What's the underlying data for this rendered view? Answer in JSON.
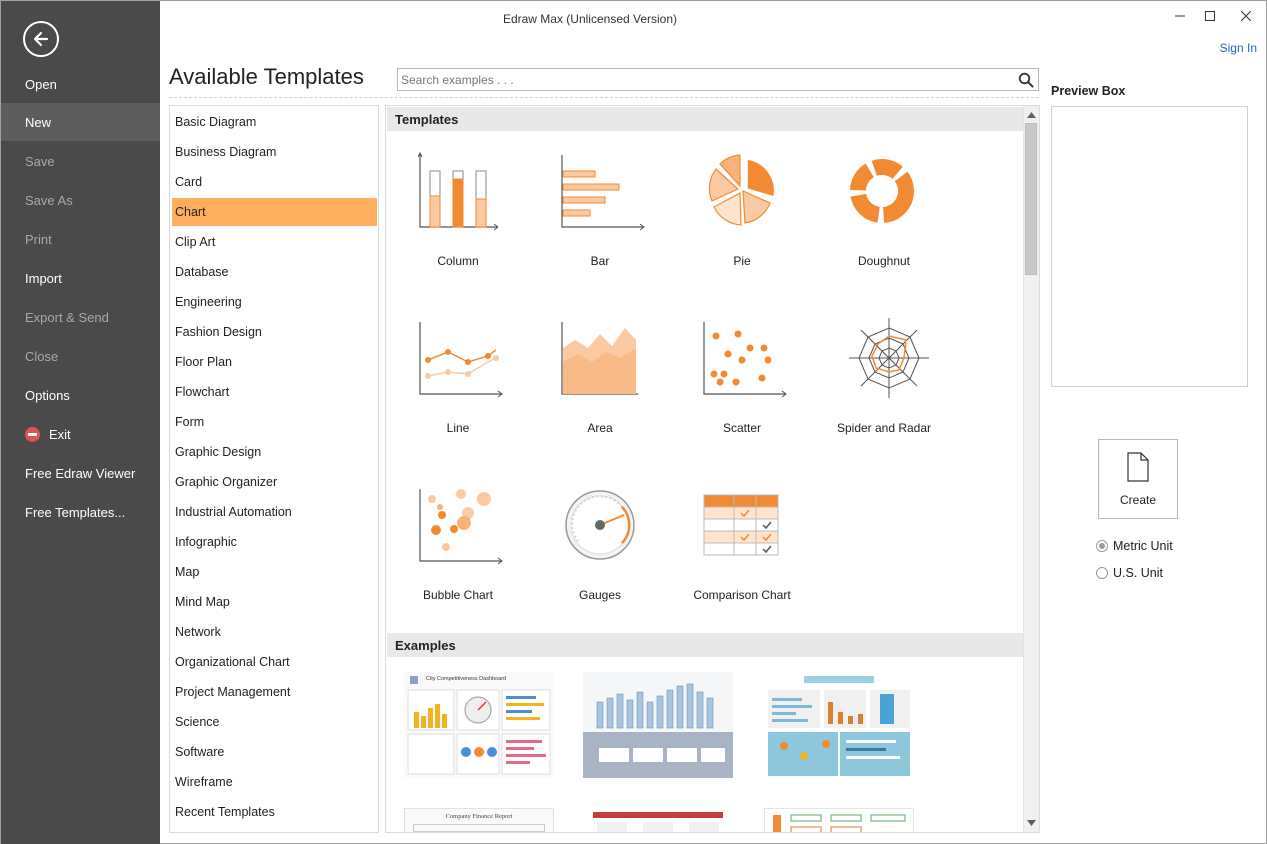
{
  "window": {
    "title": "Edraw Max (Unlicensed Version)",
    "sign_in": "Sign In"
  },
  "menu": {
    "items": [
      {
        "label": "Open"
      },
      {
        "label": "New"
      },
      {
        "label": "Save"
      },
      {
        "label": "Save As"
      },
      {
        "label": "Print"
      },
      {
        "label": "Import"
      },
      {
        "label": "Export & Send"
      },
      {
        "label": "Close"
      },
      {
        "label": "Options"
      },
      {
        "label": "Exit"
      },
      {
        "label": "Free Edraw Viewer"
      },
      {
        "label": "Free Templates..."
      }
    ],
    "active": "New",
    "disabled": [
      "Save",
      "Save As",
      "Print",
      "Export & Send",
      "Close"
    ]
  },
  "main": {
    "heading": "Available Templates",
    "search_placeholder": "Search examples . . ."
  },
  "categories": {
    "items": [
      "Basic Diagram",
      "Business Diagram",
      "Card",
      "Chart",
      "Clip Art",
      "Database",
      "Engineering",
      "Fashion Design",
      "Floor Plan",
      "Flowchart",
      "Form",
      "Graphic Design",
      "Graphic Organizer",
      "Industrial Automation",
      "Infographic",
      "Map",
      "Mind Map",
      "Network",
      "Organizational Chart",
      "Project Management",
      "Science",
      "Software",
      "Wireframe",
      "Recent Templates"
    ],
    "selected": "Chart"
  },
  "templates": {
    "header": "Templates",
    "items": [
      {
        "label": "Column",
        "icon": "column-chart-icon"
      },
      {
        "label": "Bar",
        "icon": "bar-chart-icon"
      },
      {
        "label": "Pie",
        "icon": "pie-chart-icon"
      },
      {
        "label": "Doughnut",
        "icon": "doughnut-chart-icon"
      },
      {
        "label": "Line",
        "icon": "line-chart-icon"
      },
      {
        "label": "Area",
        "icon": "area-chart-icon"
      },
      {
        "label": "Scatter",
        "icon": "scatter-chart-icon"
      },
      {
        "label": "Spider and Radar",
        "icon": "spider-radar-chart-icon"
      },
      {
        "label": "Bubble Chart",
        "icon": "bubble-chart-icon"
      },
      {
        "label": "Gauges",
        "icon": "gauge-icon"
      },
      {
        "label": "Comparison Chart",
        "icon": "comparison-chart-icon"
      }
    ]
  },
  "examples": {
    "header": "Examples",
    "items": [
      {
        "title": "City Competitiveness Dashboard"
      },
      {
        "title": ""
      },
      {
        "title": ""
      },
      {
        "title": "Company Finance Report"
      },
      {
        "title": ""
      },
      {
        "title": ""
      }
    ]
  },
  "preview": {
    "title": "Preview Box",
    "create_label": "Create",
    "units": [
      {
        "label": "Metric Unit",
        "selected": true
      },
      {
        "label": "U.S. Unit",
        "selected": false
      }
    ]
  },
  "colors": {
    "accent": "#ffae5e",
    "chart_orange": "#f28a33",
    "chart_light": "#fbc9a2",
    "sidebar": "#4a4a4a"
  }
}
